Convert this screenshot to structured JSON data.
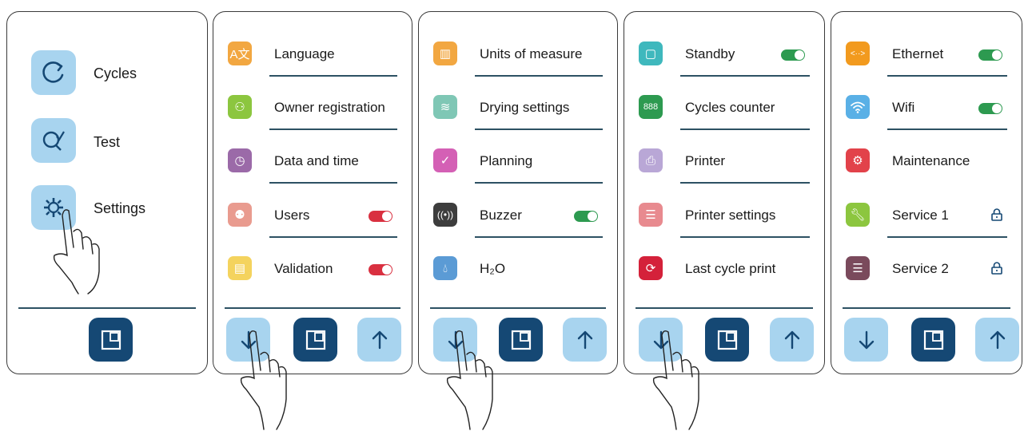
{
  "screen1": {
    "items": [
      {
        "label": "Cycles",
        "icon": "refresh-icon"
      },
      {
        "label": "Test",
        "icon": "search-check-icon"
      },
      {
        "label": "Settings",
        "icon": "gear-icon"
      }
    ],
    "home_icon": "home-panel-icon"
  },
  "screen2": {
    "items": [
      {
        "label": "Language",
        "icon": "language-icon",
        "color": "#f2a741"
      },
      {
        "label": "Owner registration",
        "icon": "owner-add-icon",
        "color": "#8cc63f"
      },
      {
        "label": "Data and time",
        "icon": "clock-icon",
        "color": "#9b6aa8"
      },
      {
        "label": "Users",
        "icon": "users-icon",
        "color": "#e99b8f",
        "toggle": "on-red"
      },
      {
        "label": "Validation",
        "icon": "validation-icon",
        "color": "#f4d35e",
        "toggle": "on-red"
      }
    ]
  },
  "screen3": {
    "items": [
      {
        "label": "Units of measure",
        "icon": "ruler-icon",
        "color": "#f2a741"
      },
      {
        "label": "Drying settings",
        "icon": "dryer-icon",
        "color": "#7fc7b5"
      },
      {
        "label": "Planning",
        "icon": "check-clock-icon",
        "color": "#d460b5"
      },
      {
        "label": "Buzzer",
        "icon": "buzzer-icon",
        "color": "#3d3d3d",
        "toggle": "on-green"
      },
      {
        "label": "H₂O",
        "icon": "water-drop-icon",
        "color": "#5b9bd5"
      }
    ]
  },
  "screen4": {
    "items": [
      {
        "label": "Standby",
        "icon": "standby-icon",
        "color": "#3fb8bd",
        "toggle": "on-green"
      },
      {
        "label": "Cycles counter",
        "icon": "counter-icon",
        "color": "#2d9a50"
      },
      {
        "label": "Printer",
        "icon": "printer-icon",
        "color": "#b9a7d6"
      },
      {
        "label": "Printer settings",
        "icon": "document-icon",
        "color": "#e88a8f"
      },
      {
        "label": "Last cycle print",
        "icon": "print-cycle-icon",
        "color": "#d4213a"
      }
    ]
  },
  "screen5": {
    "items": [
      {
        "label": "Ethernet",
        "icon": "ethernet-icon",
        "color": "#f29a1e",
        "toggle": "on-green"
      },
      {
        "label": "Wifi",
        "icon": "wifi-icon",
        "color": "#5ab0e6",
        "toggle": "on-green"
      },
      {
        "label": "Maintenance",
        "icon": "maintenance-gears-icon",
        "color": "#e2424a"
      },
      {
        "label": "Service 1",
        "icon": "wrench-icon",
        "color": "#8cc63f",
        "lock": true
      },
      {
        "label": "Service 2",
        "icon": "service-icon",
        "color": "#7a4a5c",
        "lock": true
      }
    ]
  }
}
